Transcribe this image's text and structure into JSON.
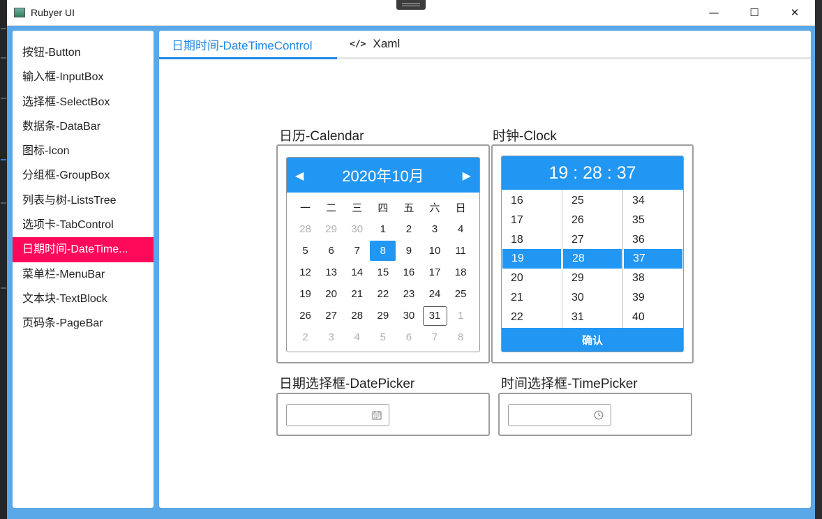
{
  "window": {
    "title": "Rubyer UI",
    "controls": [
      "—",
      "☐",
      "✕"
    ]
  },
  "sidebar": {
    "items": [
      {
        "label": "按钮-Button"
      },
      {
        "label": "输入框-InputBox"
      },
      {
        "label": "选择框-SelectBox"
      },
      {
        "label": "数据条-DataBar"
      },
      {
        "label": "图标-Icon"
      },
      {
        "label": "分组框-GroupBox"
      },
      {
        "label": "列表与树-ListsTree"
      },
      {
        "label": "选项卡-TabControl"
      },
      {
        "label": "日期时间-DateTime..."
      },
      {
        "label": "菜单栏-MenuBar"
      },
      {
        "label": "文本块-TextBlock"
      },
      {
        "label": "页码条-PageBar"
      }
    ],
    "active_index": 8,
    "active_color": "#ff0a5a"
  },
  "tabs": {
    "active": "日期时间-DateTimeControl",
    "xaml": "Xaml",
    "accent": "#1e88e5"
  },
  "calendar_section": {
    "label": "日历-Calendar",
    "month_title": "2020年10月",
    "weekdays": [
      "一",
      "二",
      "三",
      "四",
      "五",
      "六",
      "日"
    ],
    "weeks": [
      [
        "28",
        "29",
        "30",
        "1",
        "2",
        "3",
        "4"
      ],
      [
        "5",
        "6",
        "7",
        "8",
        "9",
        "10",
        "11"
      ],
      [
        "12",
        "13",
        "14",
        "15",
        "16",
        "17",
        "18"
      ],
      [
        "19",
        "20",
        "21",
        "22",
        "23",
        "24",
        "25"
      ],
      [
        "26",
        "27",
        "28",
        "29",
        "30",
        "31",
        "1"
      ],
      [
        "2",
        "3",
        "4",
        "5",
        "6",
        "7",
        "8"
      ]
    ],
    "selected_day": "8",
    "today_day": "31"
  },
  "clock_section": {
    "label": "时钟-Clock",
    "time": "19 : 28 : 37",
    "hours": [
      "16",
      "17",
      "18",
      "19",
      "20",
      "21",
      "22"
    ],
    "minutes": [
      "25",
      "26",
      "27",
      "28",
      "29",
      "30",
      "31"
    ],
    "seconds": [
      "34",
      "35",
      "36",
      "37",
      "38",
      "39",
      "40"
    ],
    "selected_row": 3,
    "confirm_label": "确认"
  },
  "datepicker_section": {
    "label": "日期选择框-DatePicker",
    "value": ""
  },
  "timepicker_section": {
    "label": "时间选择框-TimePicker",
    "value": ""
  }
}
